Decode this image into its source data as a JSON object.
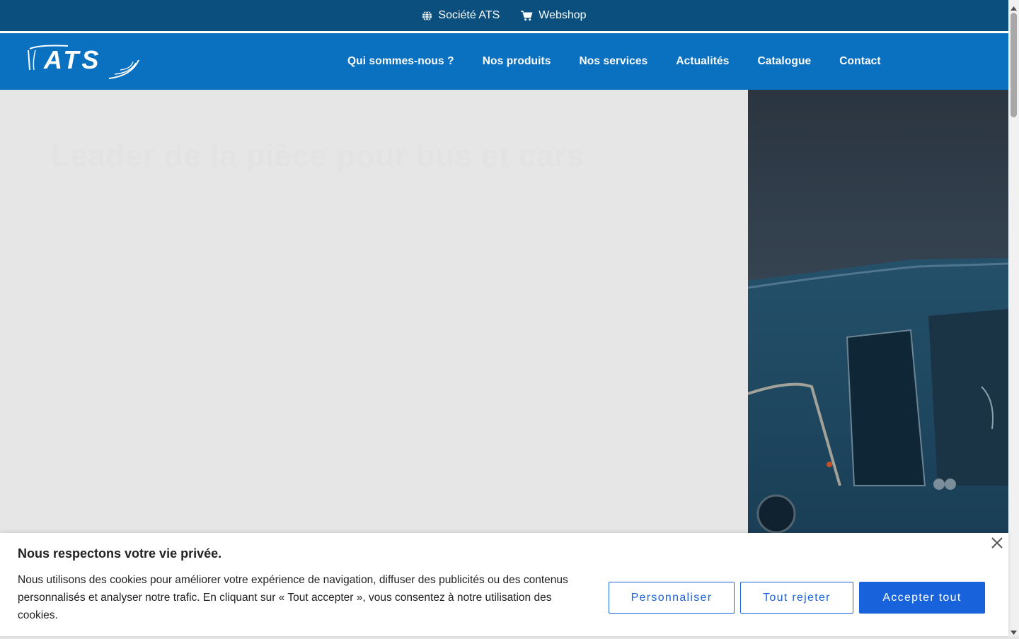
{
  "topbar": {
    "company_label": "Société ATS",
    "company_icon": "globe-icon",
    "webshop_label": "Webshop",
    "webshop_icon": "cart-icon"
  },
  "header": {
    "logo_text": "ATS",
    "nav": [
      {
        "label": "Qui sommes-nous ?"
      },
      {
        "label": "Nos produits"
      },
      {
        "label": "Nos services"
      },
      {
        "label": "Actualités"
      },
      {
        "label": "Catalogue"
      },
      {
        "label": "Contact"
      }
    ]
  },
  "hero": {
    "title": "Leader de la pièce pour bus et cars"
  },
  "cookie": {
    "title": "Nous respectons votre vie privée.",
    "text": "Nous utilisons des cookies pour améliorer votre expérience de navigation, diffuser des publicités ou des contenus personnalisés et analyser notre trafic. En cliquant sur « Tout accepter », vous consentez à notre utilisation des cookies.",
    "customize_label": "Personnaliser",
    "reject_label": "Tout rejeter",
    "accept_label": "Accepter tout"
  },
  "colors": {
    "topbar": "#0b4f7f",
    "header": "#0a70c0",
    "accent_button": "#1863dc",
    "hero_bg": "#e6e6e6"
  }
}
